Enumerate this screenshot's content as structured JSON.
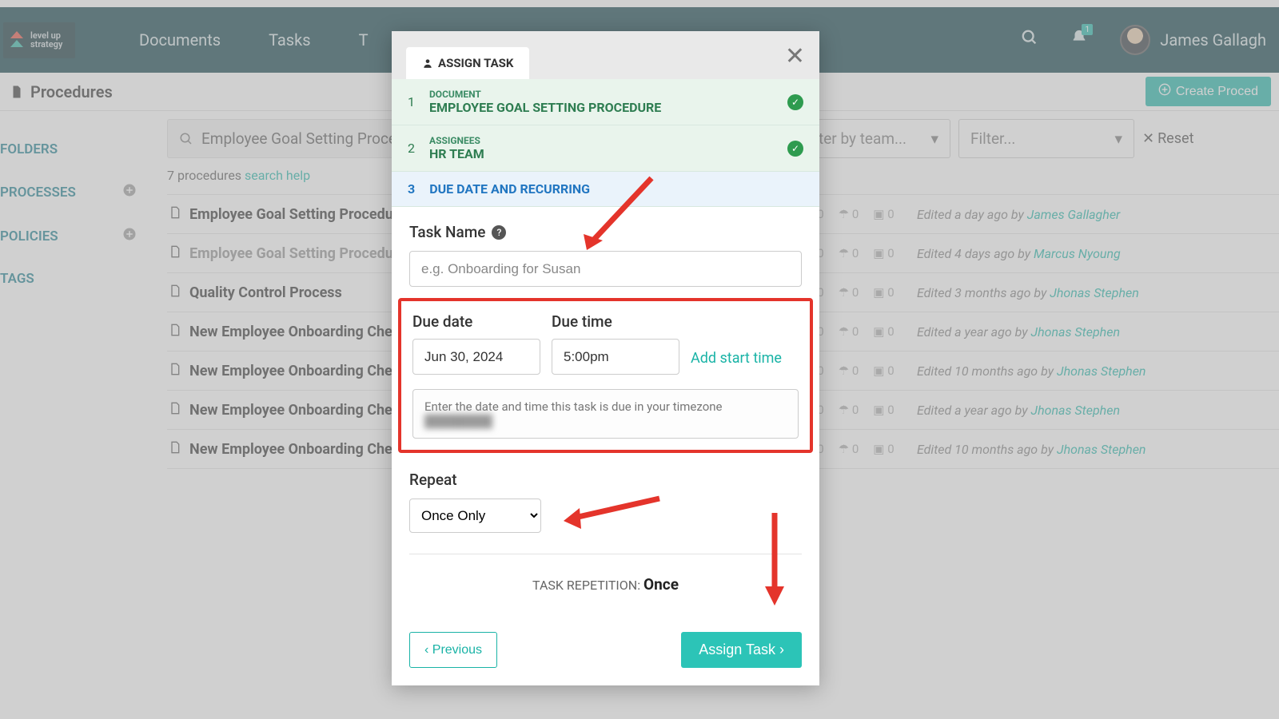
{
  "brand": {
    "line1": "level up",
    "line2": "strategy"
  },
  "nav": {
    "documents": "Documents",
    "tasks": "Tasks",
    "third": "T"
  },
  "user": {
    "name": "James Gallagh",
    "notif_count": "1"
  },
  "page": {
    "title": "Procedures",
    "create_btn": "Create Proced"
  },
  "sidebar": {
    "items": [
      {
        "label": "FOLDERS",
        "plus": false
      },
      {
        "label": "PROCESSES",
        "plus": true
      },
      {
        "label": "POLICIES",
        "plus": true
      },
      {
        "label": "TAGS",
        "plus": false
      }
    ]
  },
  "filters": {
    "search_value": "Employee Goal Setting Proce",
    "team_placeholder": "ter by team...",
    "filter_placeholder": "Filter...",
    "reset": "Reset"
  },
  "count": {
    "text": "7 procedures ",
    "link": "search help"
  },
  "procs": [
    {
      "name": "Employee Goal Setting Procedu",
      "dim": false,
      "d": "0",
      "t": "0",
      "f": "0",
      "meta_pre": "Edited a day ago by ",
      "author": "James Gallagher"
    },
    {
      "name": "Employee Goal Setting Procedu",
      "dim": true,
      "d": "0",
      "t": "0",
      "f": "0",
      "meta_pre": "Edited 4 days ago by ",
      "author": "Marcus Nyoung"
    },
    {
      "name": "Quality Control Process",
      "dim": false,
      "d": "0",
      "t": "0",
      "f": "0",
      "meta_pre": "Edited 3 months ago by ",
      "author": "Jhonas Stephen"
    },
    {
      "name": "New Employee Onboarding Che",
      "dim": false,
      "d": "0",
      "t": "0",
      "f": "0",
      "meta_pre": "Edited a year ago by ",
      "author": "Jhonas Stephen"
    },
    {
      "name": "New Employee Onboarding Che",
      "dim": false,
      "d": "0",
      "t": "0",
      "f": "0",
      "meta_pre": "Edited 10 months ago by ",
      "author": "Jhonas Stephen"
    },
    {
      "name": "New Employee Onboarding Che",
      "dim": false,
      "d": "0",
      "t": "0",
      "f": "0",
      "meta_pre": "Edited a year ago by ",
      "author": "Jhonas Stephen"
    },
    {
      "name": "New Employee Onboarding Che",
      "dim": false,
      "d": "0",
      "t": "0",
      "f": "0",
      "meta_pre": "Edited 10 months ago by ",
      "author": "Jhonas Stephen"
    }
  ],
  "modal": {
    "tab": "ASSIGN TASK",
    "steps": [
      {
        "num": "1",
        "label": "DOCUMENT",
        "value": "EMPLOYEE GOAL SETTING PROCEDURE"
      },
      {
        "num": "2",
        "label": "ASSIGNEES",
        "value": "HR TEAM"
      },
      {
        "num": "3",
        "label": "",
        "value": "DUE DATE AND RECURRING"
      }
    ],
    "task_name_label": "Task Name",
    "task_name_placeholder": "e.g. Onboarding for Susan",
    "due_date_label": "Due date",
    "due_date_value": "Jun 30, 2024",
    "due_time_label": "Due time",
    "due_time_value": "5:00pm",
    "add_start": "Add start time",
    "hint_text": "Enter the date and time this task is due in your timezone",
    "repeat_label": "Repeat",
    "repeat_value": "Once Only",
    "rep_line_label": "TASK REPETITION:",
    "rep_line_value": "Once",
    "prev": "Previous",
    "assign": "Assign Task"
  }
}
